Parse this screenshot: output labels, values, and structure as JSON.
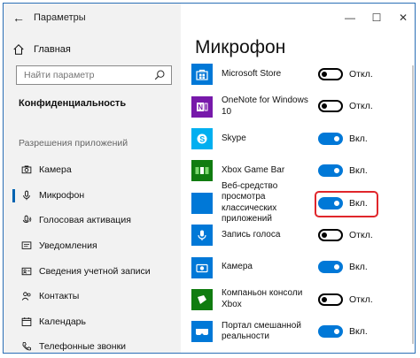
{
  "window": {
    "title": "Параметры",
    "controls": {
      "minimize": "—",
      "maximize": "☐",
      "close": "✕"
    },
    "back_glyph": "←"
  },
  "sidebar": {
    "home": "Главная",
    "search_placeholder": "Найти параметр",
    "section": "Конфиденциальность",
    "group": "Разрешения приложений",
    "items": [
      {
        "label": "Камера",
        "icon": "camera-icon",
        "active": false
      },
      {
        "label": "Микрофон",
        "icon": "microphone-icon",
        "active": true
      },
      {
        "label": "Голосовая активация",
        "icon": "voice-activation-icon",
        "active": false
      },
      {
        "label": "Уведомления",
        "icon": "notifications-icon",
        "active": false
      },
      {
        "label": "Сведения учетной записи",
        "icon": "account-info-icon",
        "active": false
      },
      {
        "label": "Контакты",
        "icon": "contacts-icon",
        "active": false
      },
      {
        "label": "Календарь",
        "icon": "calendar-icon",
        "active": false
      },
      {
        "label": "Телефонные звонки",
        "icon": "phone-calls-icon",
        "active": false
      }
    ]
  },
  "main": {
    "title": "Микрофон",
    "on_label": "Вкл.",
    "off_label": "Откл.",
    "apps": [
      {
        "name": "Microsoft Store",
        "icon": "microsoft-store-icon",
        "color": "#0078d7",
        "on": false
      },
      {
        "name": "OneNote for Windows 10",
        "icon": "onenote-icon",
        "color": "#7719aa",
        "on": false
      },
      {
        "name": "Skype",
        "icon": "skype-icon",
        "color": "#00aff0",
        "on": true
      },
      {
        "name": "Xbox Game Bar",
        "icon": "xbox-game-bar-icon",
        "color": "#107c10",
        "on": true
      },
      {
        "name": "Веб-средство просмотра классических приложений",
        "icon": "webview-icon",
        "color": "#0078d7",
        "on": true,
        "highlighted": true
      },
      {
        "name": "Запись голоса",
        "icon": "voice-recorder-icon",
        "color": "#0078d7",
        "on": false
      },
      {
        "name": "Камера",
        "icon": "camera-app-icon",
        "color": "#0078d7",
        "on": true
      },
      {
        "name": "Компаньон консоли Xbox",
        "icon": "xbox-companion-icon",
        "color": "#107c10",
        "on": false
      },
      {
        "name": "Портал смешанной реальности",
        "icon": "mixed-reality-icon",
        "color": "#0078d7",
        "on": true
      }
    ]
  },
  "colors": {
    "accent": "#0078d7",
    "highlight_border": "#e0262b",
    "sidebar_bg": "#f2f2f2"
  }
}
